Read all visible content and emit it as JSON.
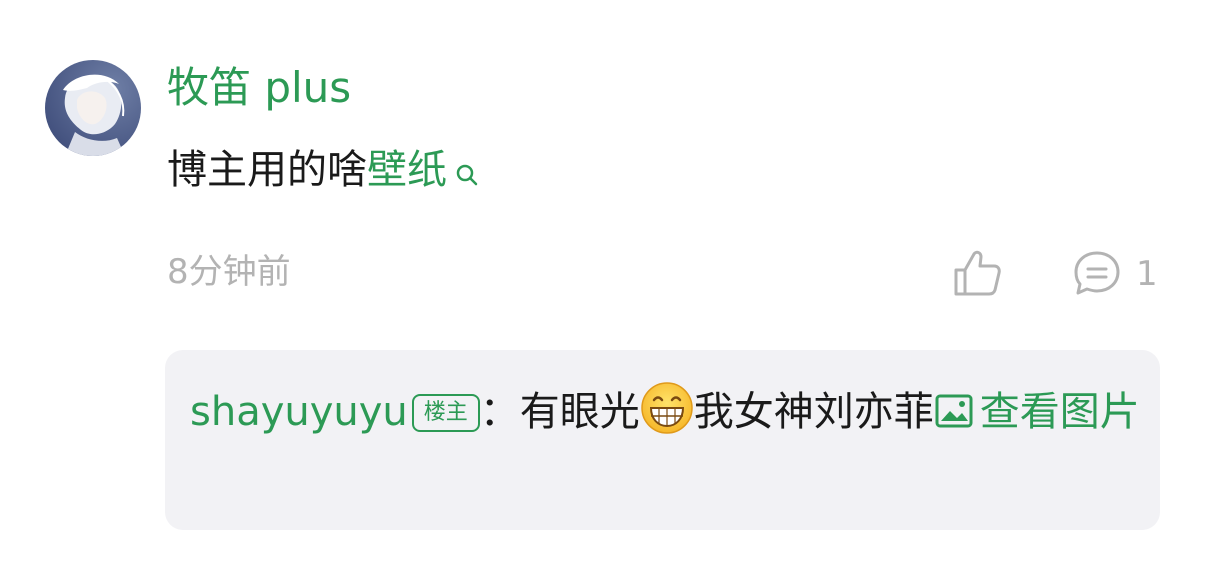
{
  "comment": {
    "username": "牧笛 plus",
    "text_prefix": "博主用的啥",
    "keyword": "壁纸",
    "time": "8分钟前",
    "reply_count": "1"
  },
  "reply": {
    "author": "shayuyuyu",
    "badge": "楼主",
    "separator": "：",
    "text_before_emoji": "有眼光",
    "text_after_emoji": "我女神刘亦菲",
    "view_image_label": "查看图片"
  },
  "colors": {
    "accent": "#2c9a55",
    "text": "#1a1a1a",
    "muted": "#b3b3b3",
    "reply_bg": "#f2f2f5"
  },
  "icons": {
    "keyword_search": "search-icon",
    "like": "thumbs-up-icon",
    "reply": "comment-bubble-icon",
    "emoji": "grinning-face-emoji-icon",
    "image": "image-icon"
  }
}
